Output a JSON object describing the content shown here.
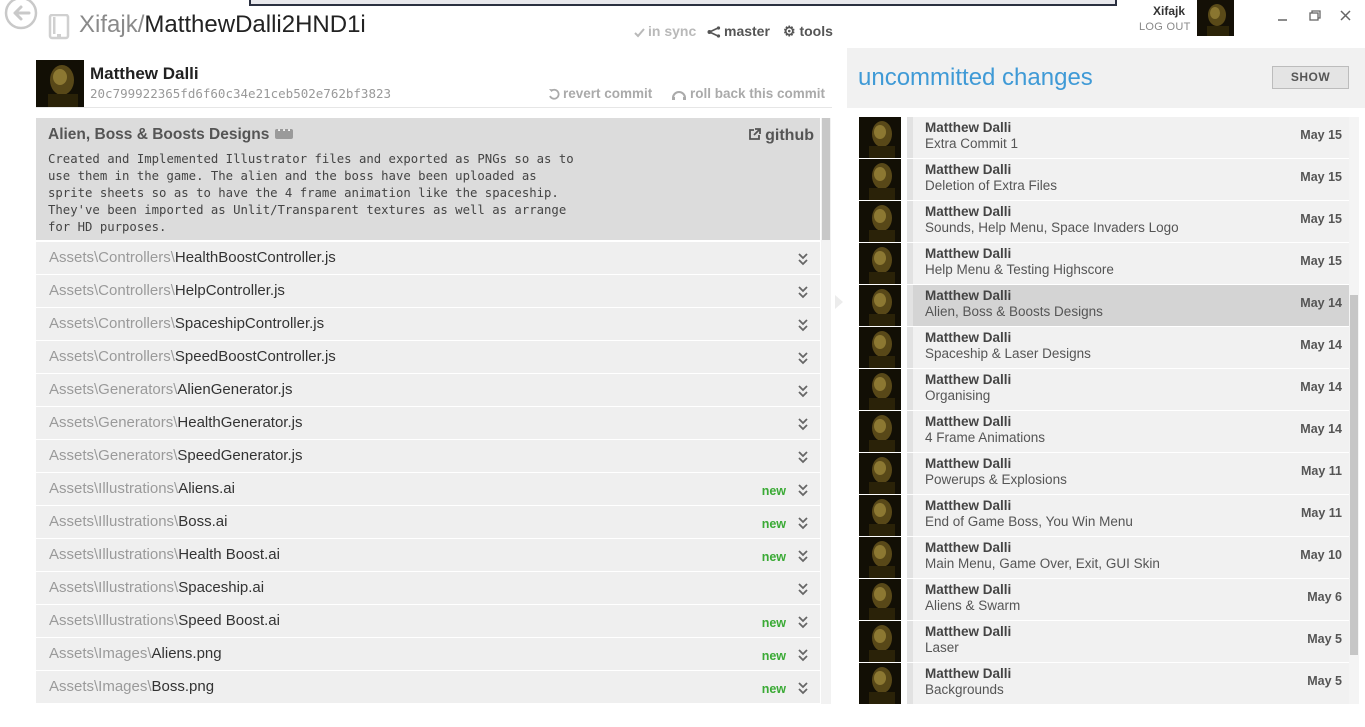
{
  "header": {
    "repo_owner": "Xifajk",
    "repo_separator": "/",
    "repo_name": "MatthewDalli2HND1i",
    "sync_status": "in sync",
    "branch": "master",
    "tools_label": "tools"
  },
  "account": {
    "username": "Xifajk",
    "logout_label": "LOG OUT"
  },
  "commit": {
    "author": "Matthew Dalli",
    "hash": "20c799922365fd6f60c34e21ceb502e762bf3823",
    "revert_label": "revert commit",
    "rollback_label": "roll back this commit",
    "title": "Alien, Boss & Boosts Designs",
    "github_label": "github",
    "message": "Created and Implemented Illustrator files and exported as PNGs so as to\nuse them in the game. The alien and the boss have been uploaded as\nsprite sheets so as to have the 4 frame animation like the spaceship.\nThey've been imported as Unlit/Transparent textures as well as arrange\nfor HD purposes."
  },
  "files": [
    {
      "dir": "Assets\\Controllers\\",
      "name": "HealthBoostController.js",
      "badge": ""
    },
    {
      "dir": "Assets\\Controllers\\",
      "name": "HelpController.js",
      "badge": ""
    },
    {
      "dir": "Assets\\Controllers\\",
      "name": "SpaceshipController.js",
      "badge": ""
    },
    {
      "dir": "Assets\\Controllers\\",
      "name": "SpeedBoostController.js",
      "badge": ""
    },
    {
      "dir": "Assets\\Generators\\",
      "name": "AlienGenerator.js",
      "badge": ""
    },
    {
      "dir": "Assets\\Generators\\",
      "name": "HealthGenerator.js",
      "badge": ""
    },
    {
      "dir": "Assets\\Generators\\",
      "name": "SpeedGenerator.js",
      "badge": ""
    },
    {
      "dir": "Assets\\Illustrations\\",
      "name": "Aliens.ai",
      "badge": "new"
    },
    {
      "dir": "Assets\\Illustrations\\",
      "name": "Boss.ai",
      "badge": "new"
    },
    {
      "dir": "Assets\\Illustrations\\",
      "name": "Health Boost.ai",
      "badge": "new"
    },
    {
      "dir": "Assets\\Illustrations\\",
      "name": "Spaceship.ai",
      "badge": ""
    },
    {
      "dir": "Assets\\Illustrations\\",
      "name": "Speed Boost.ai",
      "badge": "new"
    },
    {
      "dir": "Assets\\Images\\",
      "name": "Aliens.png",
      "badge": "new"
    },
    {
      "dir": "Assets\\Images\\",
      "name": "Boss.png",
      "badge": "new"
    }
  ],
  "uncommitted": {
    "title": "uncommitted changes",
    "show_label": "SHOW"
  },
  "history": [
    {
      "author": "Matthew Dalli",
      "message": "Extra Commit 1",
      "date": "May 15",
      "selected": false
    },
    {
      "author": "Matthew Dalli",
      "message": "Deletion of Extra Files",
      "date": "May 15",
      "selected": false
    },
    {
      "author": "Matthew Dalli",
      "message": "Sounds, Help Menu, Space Invaders Logo",
      "date": "May 15",
      "selected": false
    },
    {
      "author": "Matthew Dalli",
      "message": "Help Menu & Testing Highscore",
      "date": "May 15",
      "selected": false
    },
    {
      "author": "Matthew Dalli",
      "message": "Alien, Boss & Boosts Designs",
      "date": "May 14",
      "selected": true
    },
    {
      "author": "Matthew Dalli",
      "message": "Spaceship & Laser Designs",
      "date": "May 14",
      "selected": false
    },
    {
      "author": "Matthew Dalli",
      "message": "Organising",
      "date": "May 14",
      "selected": false
    },
    {
      "author": "Matthew Dalli",
      "message": "4 Frame Animations",
      "date": "May 14",
      "selected": false
    },
    {
      "author": "Matthew Dalli",
      "message": "Powerups & Explosions",
      "date": "May 11",
      "selected": false
    },
    {
      "author": "Matthew Dalli",
      "message": "End of Game Boss, You Win Menu",
      "date": "May 11",
      "selected": false
    },
    {
      "author": "Matthew Dalli",
      "message": "Main Menu, Game Over, Exit, GUI Skin",
      "date": "May 10",
      "selected": false
    },
    {
      "author": "Matthew Dalli",
      "message": "Aliens & Swarm",
      "date": "May 6",
      "selected": false
    },
    {
      "author": "Matthew Dalli",
      "message": "Laser",
      "date": "May 5",
      "selected": false
    },
    {
      "author": "Matthew Dalli",
      "message": "Backgrounds",
      "date": "May 5",
      "selected": false
    }
  ],
  "colors": {
    "accent": "#3f9ad6",
    "new_badge": "#3aaa35",
    "selected_row": "#d4d4d4"
  }
}
